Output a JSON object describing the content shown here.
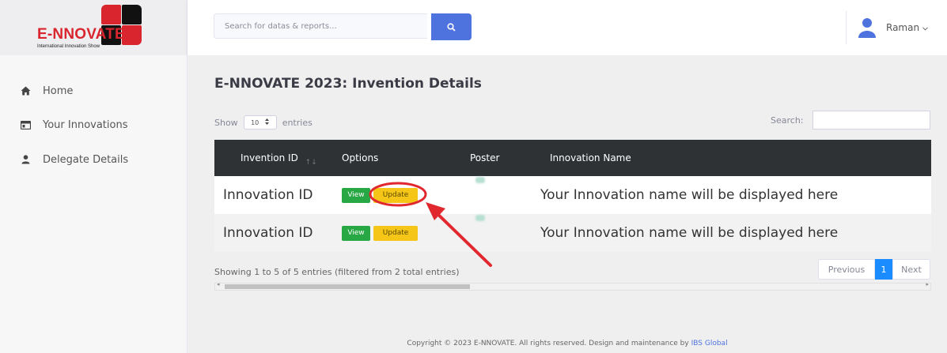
{
  "brand": {
    "name": "E-NNOVATE",
    "tagline": "International Innovation Show",
    "colors": {
      "red": "#d9262e",
      "black": "#111111"
    }
  },
  "sidebar": {
    "items": [
      {
        "label": "Home",
        "icon": "home-icon"
      },
      {
        "label": "Your Innovations",
        "icon": "id-card-icon"
      },
      {
        "label": "Delegate Details",
        "icon": "user-icon"
      }
    ]
  },
  "topbar": {
    "search_placeholder": "Search for datas & reports...",
    "search_icon": "search-icon",
    "user_name": "Raman",
    "accent": "#4e73df"
  },
  "page": {
    "title": "E-NNOVATE 2023: Invention Details",
    "show_label": "Show",
    "entries_select": "10",
    "entries_label": "entries",
    "search_label": "Search:"
  },
  "table": {
    "columns": [
      "Invention ID",
      "Options",
      "Poster",
      "Innovation Name"
    ],
    "view_label": "View",
    "update_label": "Update",
    "rows": [
      {
        "id": "Innovation ID",
        "name": "Your Innovation name will be displayed here"
      },
      {
        "id": "Innovation ID",
        "name": "Your Innovation name will be displayed here"
      }
    ]
  },
  "pagination": {
    "info": "Showing 1 to 5 of 5 entries (filtered from 2 total entries)",
    "previous": "Previous",
    "current": "1",
    "next": "Next"
  },
  "footer": {
    "text": "Copyright © 2023 E-NNOVATE. All rights reserved. Design and maintenance by",
    "link": "IBS Global"
  },
  "annotation_color": "#e0282e"
}
